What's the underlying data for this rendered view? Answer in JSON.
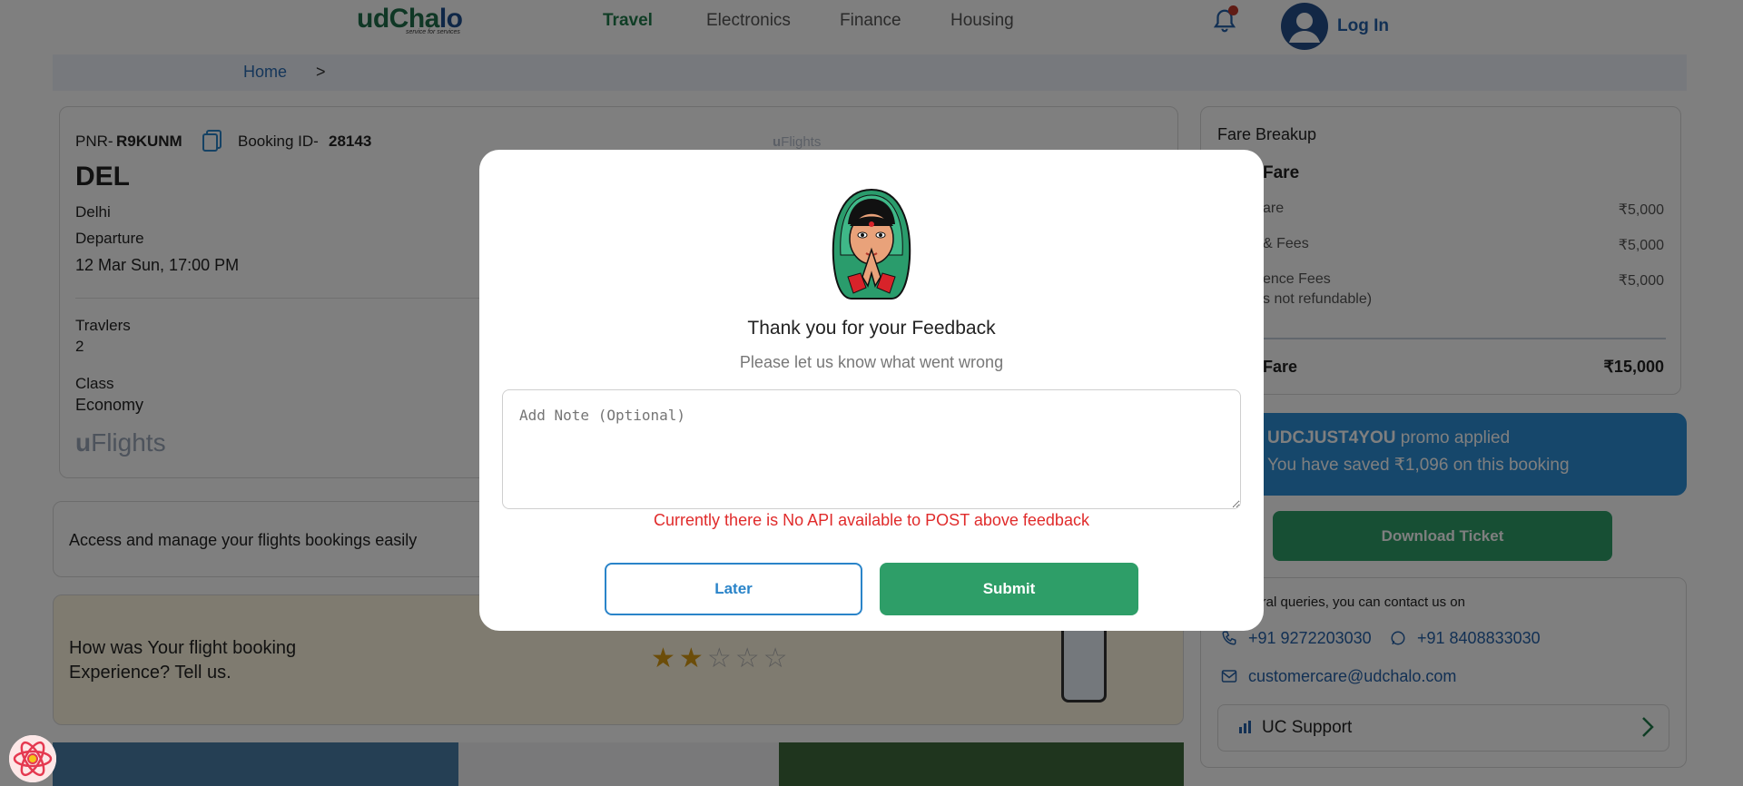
{
  "header": {
    "logo_text_a": "udCha",
    "logo_text_b": "lo",
    "logo_tagline": "service for services",
    "nav": [
      {
        "label": "Travel"
      },
      {
        "label": "Electronics"
      },
      {
        "label": "Finance"
      },
      {
        "label": "Housing"
      }
    ],
    "login_label": "Log In"
  },
  "breadcrumb": {
    "home": "Home",
    "separator": ">"
  },
  "booking": {
    "pnr_label": "PNR-",
    "pnr_value": "R9KUNM",
    "booking_id_label": "Booking ID-",
    "booking_id_value": "28143",
    "code": "DEL",
    "city": "Delhi",
    "departure_label": "Departure",
    "departure_time": "12 Mar Sun, 17:00 PM",
    "travellers_label": "Travlers",
    "travellers_value": "2",
    "class_label": "Class",
    "class_value": "Economy",
    "brand_u": "u",
    "brand_flights": "Flights"
  },
  "manage_text": "Access and manage your flights bookings easily",
  "rating": {
    "question_line1": "How was Your flight booking",
    "question_line2": "Experience? Tell us.",
    "stars_filled": 2,
    "stars_total": 5
  },
  "fare": {
    "title": "Fare Breakup",
    "subtitle": "Fare",
    "rows": [
      {
        "label": "are",
        "value": "₹5,000"
      },
      {
        "label": "& Fees",
        "value": "₹5,000"
      },
      {
        "label": "ence Fees",
        "value": "₹5,000",
        "note": "s not refundable)"
      }
    ],
    "total_label": "Fare",
    "total_value": "₹15,000"
  },
  "promo": {
    "line1_code": "UDCJUST4YOU",
    "line1_rest": " promo applied",
    "line2": "You have saved ₹1,096 on this booking"
  },
  "download_label": "Download Ticket",
  "contact": {
    "heading": "neral queries, you can contact us on",
    "phone1": "+91 9272203030",
    "phone2": "+91 8408833030",
    "email": "customercare@udchalo.com",
    "support_label": "UC Support"
  },
  "modal": {
    "title": "Thank you for your Feedback",
    "subtitle": "Please let us know what went wrong",
    "note_placeholder": "Add Note (Optional)",
    "error": "Currently there is No API available to POST above feedback",
    "later_label": "Later",
    "submit_label": "Submit"
  },
  "colors": {
    "brand_green": "#2e9e68",
    "brand_blue": "#2a84c9",
    "error_red": "#e02b2b",
    "promo_blue": "#2d8fd6"
  }
}
